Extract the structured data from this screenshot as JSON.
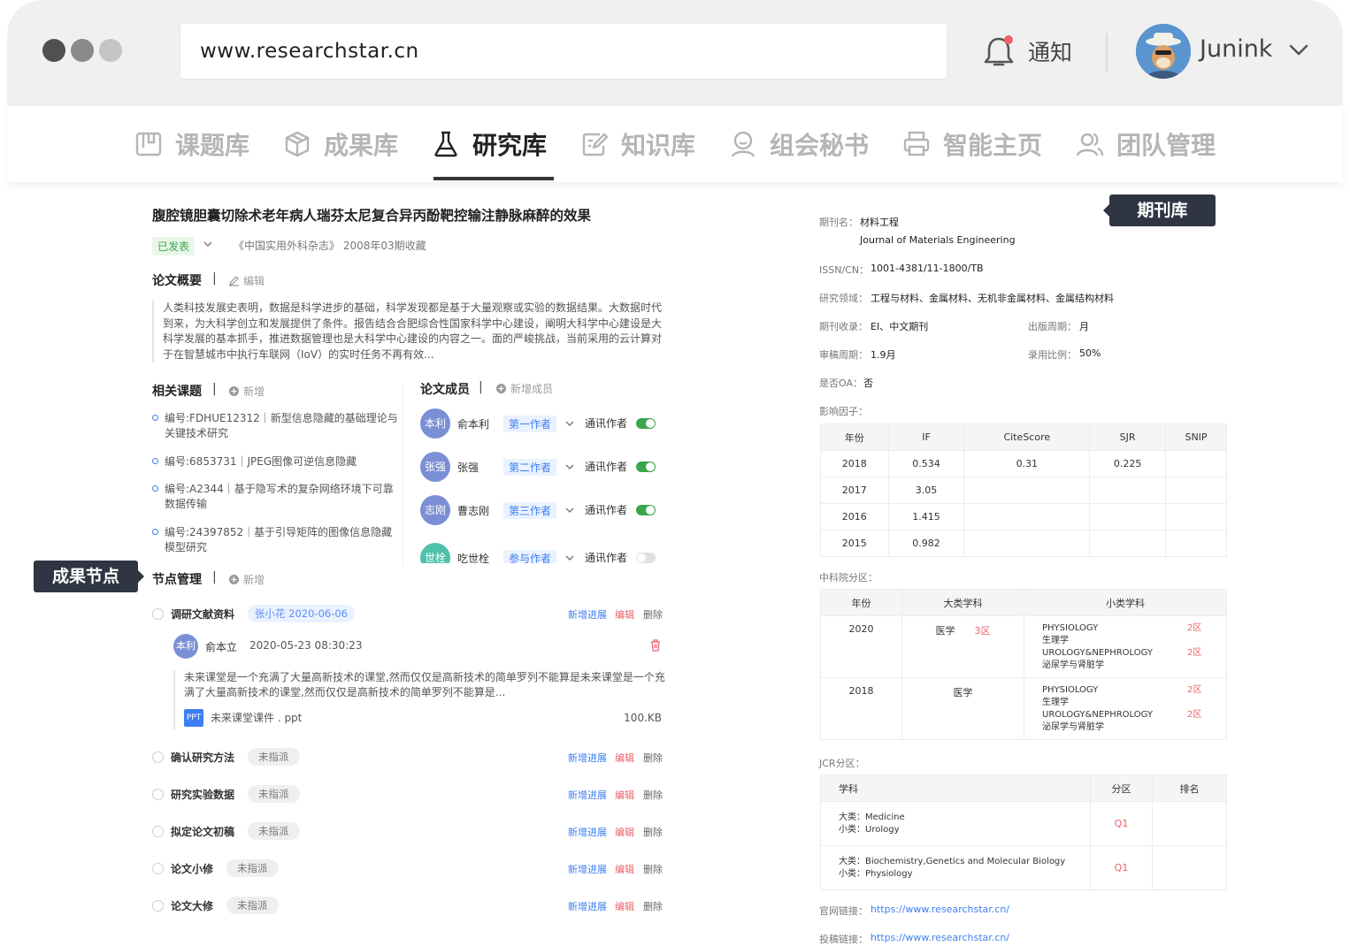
{
  "browser": {
    "url": "www.researchstar.cn",
    "notify_label": "通知",
    "username": "Junink"
  },
  "nav": {
    "items": [
      {
        "label": "课题库",
        "icon": "topic-library-icon"
      },
      {
        "label": "成果库",
        "icon": "cube-icon"
      },
      {
        "label": "研究库",
        "icon": "flask-icon",
        "active": true
      },
      {
        "label": "知识库",
        "icon": "edit-note-icon"
      },
      {
        "label": "组会秘书",
        "icon": "person-icon"
      },
      {
        "label": "智能主页",
        "icon": "printer-icon"
      },
      {
        "label": "团队管理",
        "icon": "team-icon"
      }
    ]
  },
  "paper": {
    "title": "腹腔镜胆囊切除术老年病人瑞芬太尼复合异丙酚靶控输注静脉麻醉的效果",
    "status": "已发表",
    "source": "《中国实用外科杂志》 2008年03期收藏"
  },
  "summary": {
    "title": "论文概要",
    "action": "编辑",
    "text": "人类科技发展史表明，数据是科学进步的基础，科学发现都是基于大量观察或实验的数据结果。大数据时代到来，为大科学创立和发展提供了条件。报告结合合肥综合性国家科学中心建设，阐明大科学中心建设是大科学发展的基本抓手，推进数据管理也是大科学中心建设的内容之一。面的严峻挑战，当前采用的云计算对于在智慧城市中执行车联网（IoV）的实时任务不再有效..."
  },
  "topics": {
    "title": "相关课题",
    "action": "新增",
    "items": [
      "编号:FDHUE12312｜新型信息隐藏的基础理论与关键技术研究",
      "编号:6853731｜JPEG图像可逆信息隐藏",
      "编号:A2344｜基于隐写术的复杂网络环境下可靠数据传输",
      "编号:24397852｜基于引导矩阵的图像信息隐藏模型研究"
    ]
  },
  "members": {
    "title": "论文成员",
    "action": "新增成员",
    "items": [
      {
        "avatar": "本利",
        "name": "俞本利",
        "role": "第一作者",
        "corr": "通讯作者",
        "on": true,
        "color": "#7b8fd6"
      },
      {
        "avatar": "张强",
        "name": "张强",
        "role": "第二作者",
        "corr": "通讯作者",
        "on": true,
        "color": "#7b8fd6"
      },
      {
        "avatar": "志刚",
        "name": "曹志刚",
        "role": "第三作者",
        "corr": "通讯作者",
        "on": true,
        "color": "#7b8fd6"
      },
      {
        "avatar": "世栓",
        "name": "吃世栓",
        "role": "参与作者",
        "corr": "通讯作者",
        "on": false,
        "color": "#4ec1ab"
      }
    ]
  },
  "callouts": {
    "node": "成果节点",
    "journal": "期刊库"
  },
  "nodes": {
    "title": "节点管理",
    "action": "新增",
    "act_progress": "新增进展",
    "act_edit": "编辑",
    "act_delete": "删除",
    "items": [
      {
        "name": "调研文献资料",
        "tag": "张小花 2020-06-06",
        "assigned": true
      },
      {
        "name": "确认研究方法",
        "tag": "未指派",
        "assigned": false
      },
      {
        "name": "研究实验数据",
        "tag": "未指派",
        "assigned": false
      },
      {
        "name": "拟定论文初稿",
        "tag": "未指派",
        "assigned": false
      },
      {
        "name": "论文小修",
        "tag": "未指派",
        "assigned": false
      },
      {
        "name": "论文大修",
        "tag": "未指派",
        "assigned": false
      }
    ],
    "comment": {
      "avatar": "本利",
      "author": "俞本立",
      "time": "2020-05-23 08:30:23",
      "text": "未来课堂是一个充满了大量高新技术的课堂,然而仅仅是高新技术的简单罗列不能算是未来课堂是一个充满了大量高新技术的课堂,然而仅仅是高新技术的简单罗列不能算是...",
      "file_type": "PPT",
      "file_name": "未来课堂课件 . ppt",
      "file_size": "100.KB"
    }
  },
  "journal": {
    "name_label": "期刊名：",
    "name_cn": "材料工程",
    "name_en": "Journal of Materials Engineering",
    "issn_label": "ISSN/CN：",
    "issn": "1001-4381/11-1800/TB",
    "field_label": "研究领域：",
    "field": "工程与材料、金属材料、无机非金属材料、金属结构材料",
    "indexed_label": "期刊收录：",
    "indexed": "EI、中文期刊",
    "cycle_label": "出版周期：",
    "cycle": "月",
    "review_label": "审稿周期：",
    "review": "1.9月",
    "accept_label": "录用比例：",
    "accept": "50%",
    "oa_label": "是否OA：",
    "oa": "否",
    "if_label": "影响因子：",
    "if_headers": [
      "年份",
      "IF",
      "CiteScore",
      "SJR",
      "SNIP"
    ],
    "if_rows": [
      [
        "2018",
        "0.534",
        "0.31",
        "0.225",
        ""
      ],
      [
        "2017",
        "3.05",
        "",
        "",
        ""
      ],
      [
        "2016",
        "1.415",
        "",
        "",
        ""
      ],
      [
        "2015",
        "0.982",
        "",
        "",
        ""
      ]
    ],
    "cas_label": "中科院分区：",
    "cas_headers": [
      "年份",
      "大类学科",
      "小类学科"
    ],
    "cas_rows": [
      {
        "year": "2020",
        "major": "医学",
        "major_zone": "3区",
        "subs": [
          {
            "en": "PHYSIOLOGY",
            "cn": "生理学",
            "zone": "2区"
          },
          {
            "en": "UROLOGY&NEPHROLOGY",
            "cn": "泌尿学与肾脏学",
            "zone": "2区"
          }
        ]
      },
      {
        "year": "2018",
        "major": "医学",
        "major_zone": "",
        "subs": [
          {
            "en": "PHYSIOLOGY",
            "cn": "生理学",
            "zone": "2区"
          },
          {
            "en": "UROLOGY&NEPHROLOGY",
            "cn": "泌尿学与肾脏学",
            "zone": "2区"
          }
        ]
      }
    ],
    "jcr_label": "JCR分区：",
    "jcr_headers": [
      "学科",
      "分区",
      "排名"
    ],
    "jcr_rows": [
      {
        "major": "大类：Medicine",
        "minor": "小类：Urology",
        "zone": "Q1",
        "rank": ""
      },
      {
        "major": "大类：Biochemistry,Genetics and Molecular Biology",
        "minor": "小类：Physiology",
        "zone": "Q1",
        "rank": ""
      }
    ],
    "website_label": "官网链接：",
    "website": "https://www.researchstar.cn/",
    "submit_label": "投稿链接：",
    "submit": "https://www.researchstar.cn/"
  }
}
